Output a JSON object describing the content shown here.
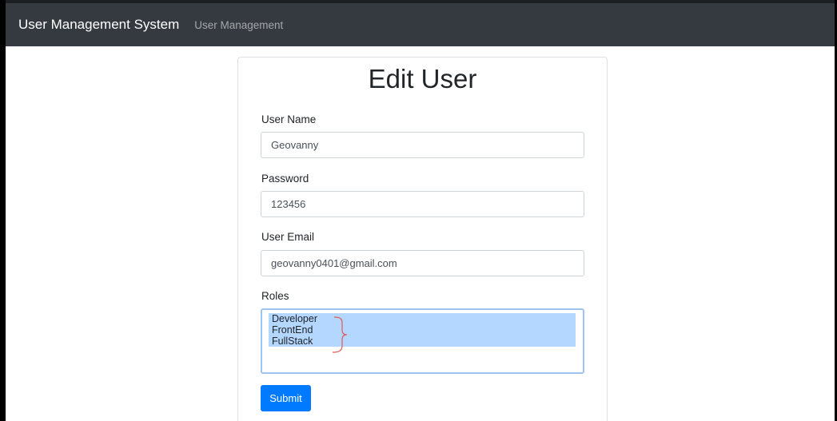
{
  "navbar": {
    "brand": "User Management System",
    "link": "User Management"
  },
  "form": {
    "title": "Edit User",
    "username_label": "User Name",
    "username_value": "Geovanny",
    "password_label": "Password",
    "password_value": "123456",
    "email_label": "User Email",
    "email_value": "geovanny0401@gmail.com",
    "roles_label": "Roles",
    "roles": [
      "Developer",
      "FrontEnd",
      "FullStack"
    ],
    "submit_label": "Submit"
  },
  "colors": {
    "navbar": "#343a40",
    "primary": "#007bff",
    "selection": "#b3d7ff",
    "annotation": "#e05a5a"
  }
}
